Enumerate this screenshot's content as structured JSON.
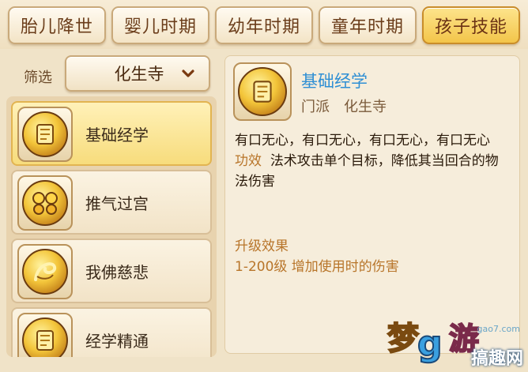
{
  "tabs": [
    {
      "label": "胎儿降世",
      "active": false
    },
    {
      "label": "婴儿时期",
      "active": false
    },
    {
      "label": "幼年时期",
      "active": false
    },
    {
      "label": "童年时期",
      "active": false
    },
    {
      "label": "孩子技能",
      "active": true
    }
  ],
  "filter": {
    "label": "筛选",
    "selected": "化生寺"
  },
  "skills": [
    {
      "name": "基础经学",
      "icon": "scroll-icon",
      "selected": true
    },
    {
      "name": "推气过宫",
      "icon": "twin-gourds-icon",
      "selected": false
    },
    {
      "name": "我佛慈悲",
      "icon": "swirl-icon",
      "selected": false
    },
    {
      "name": "经学精通",
      "icon": "scroll-icon",
      "selected": false
    }
  ],
  "detail": {
    "title": "基础经学",
    "school_label": "门派",
    "school": "化生寺",
    "description": "有口无心，有口无心，有口无心，有口无心",
    "effect_label": "功效",
    "effect_text": "法术攻击单个目标，降低其当回合的物法伤害",
    "upgrade_title": "升级效果",
    "upgrade_text": "1-200级 增加使用时的伤害"
  },
  "watermark": {
    "site": "gao7.com",
    "brand": "搞趣网"
  },
  "colors": {
    "active_tab": "#f3c54a",
    "title_blue": "#2f8fd4",
    "accent_orange": "#b8752a"
  }
}
